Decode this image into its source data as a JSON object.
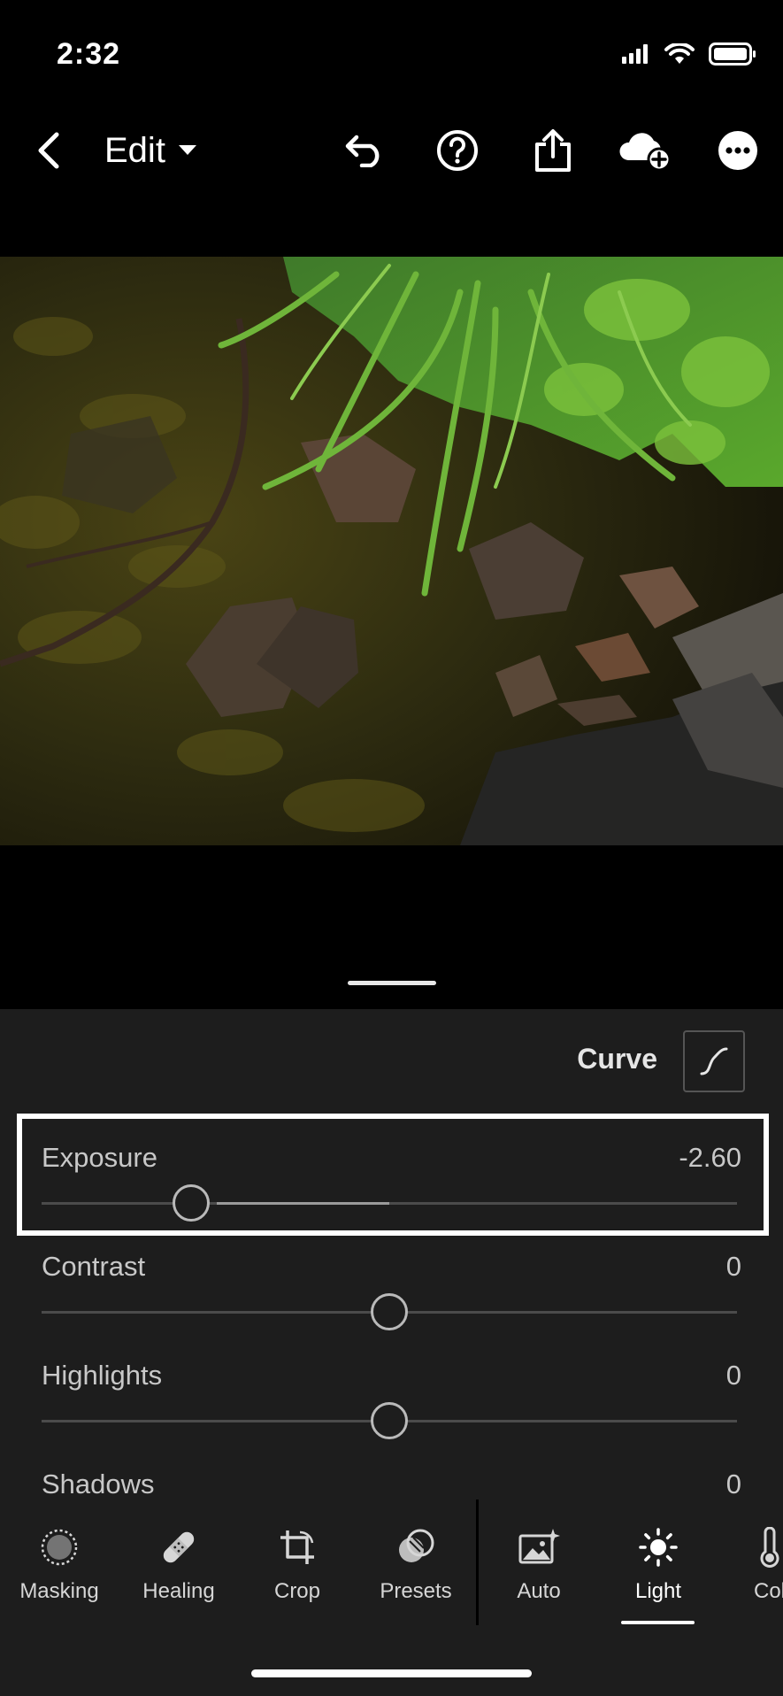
{
  "status_bar": {
    "time": "2:32"
  },
  "toolbar": {
    "edit_label": "Edit",
    "icons": [
      "back-icon",
      "dropdown-icon",
      "undo-icon",
      "help-icon",
      "share-icon",
      "cloud-add-icon",
      "more-icon"
    ]
  },
  "panel": {
    "curve_label": "Curve",
    "sliders": [
      {
        "label": "Exposure",
        "value": "-2.60",
        "position": 0.215
      },
      {
        "label": "Contrast",
        "value": "0",
        "position": 0.5
      },
      {
        "label": "Highlights",
        "value": "0",
        "position": 0.5
      },
      {
        "label": "Shadows",
        "value": "0",
        "position": 0.5
      }
    ]
  },
  "tabs": [
    {
      "label": "Masking",
      "icon": "masking-icon"
    },
    {
      "label": "Healing",
      "icon": "bandage-icon"
    },
    {
      "label": "Crop",
      "icon": "crop-icon"
    },
    {
      "label": "Presets",
      "icon": "presets-icon"
    },
    {
      "label": "Auto",
      "icon": "auto-icon"
    },
    {
      "label": "Light",
      "icon": "sun-icon",
      "active": true
    },
    {
      "label": "Col",
      "icon": "thermometer-icon"
    }
  ],
  "colors": {
    "background": "#000000",
    "panel": "#1d1d1d",
    "accent": "#ffffff"
  }
}
